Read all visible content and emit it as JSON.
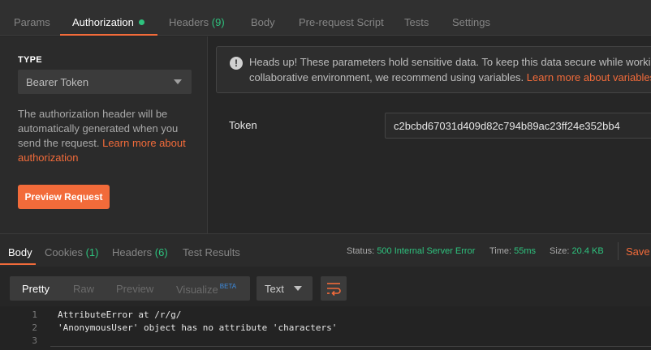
{
  "request_tabs": [
    {
      "label": "Params"
    },
    {
      "label": "Authorization"
    },
    {
      "label": "Headers",
      "count": "(9)"
    },
    {
      "label": "Body"
    },
    {
      "label": "Pre-request Script"
    },
    {
      "label": "Tests"
    },
    {
      "label": "Settings"
    }
  ],
  "auth": {
    "type_label": "TYPE",
    "type_value": "Bearer Token",
    "description": "The authorization header will be automatically generated when you send the request.",
    "learn_more": "Learn more about authorization",
    "preview_button": "Preview Request"
  },
  "alert": {
    "line1": "Heads up! These parameters hold sensitive data. To keep this data secure while working",
    "line2": "collaborative environment, we recommend using variables.",
    "link": "Learn more about variables"
  },
  "token": {
    "label": "Token",
    "value": "c2bcbd67031d409d82c794b89ac23ff24e352bb4"
  },
  "response_tabs": [
    {
      "label": "Body"
    },
    {
      "label": "Cookies",
      "count": "(1)"
    },
    {
      "label": "Headers",
      "count": "(6)"
    },
    {
      "label": "Test Results"
    }
  ],
  "response_meta": {
    "status_label": "Status:",
    "status_value": "500 Internal Server Error",
    "time_label": "Time:",
    "time_value": "55ms",
    "size_label": "Size:",
    "size_value": "20.4 KB",
    "save": "Save"
  },
  "view_modes": [
    "Pretty",
    "Raw",
    "Preview",
    "Visualize"
  ],
  "beta_badge": "BETA",
  "format": "Text",
  "code_lines": [
    {
      "n": "1",
      "text": "AttributeError at /r/g/"
    },
    {
      "n": "2",
      "text": "'AnonymousUser' object has no attribute 'characters'"
    },
    {
      "n": "3",
      "text": ""
    }
  ],
  "colors": {
    "accent": "#f26b3a",
    "success_green": "#2ec27e",
    "background": "#262626"
  }
}
